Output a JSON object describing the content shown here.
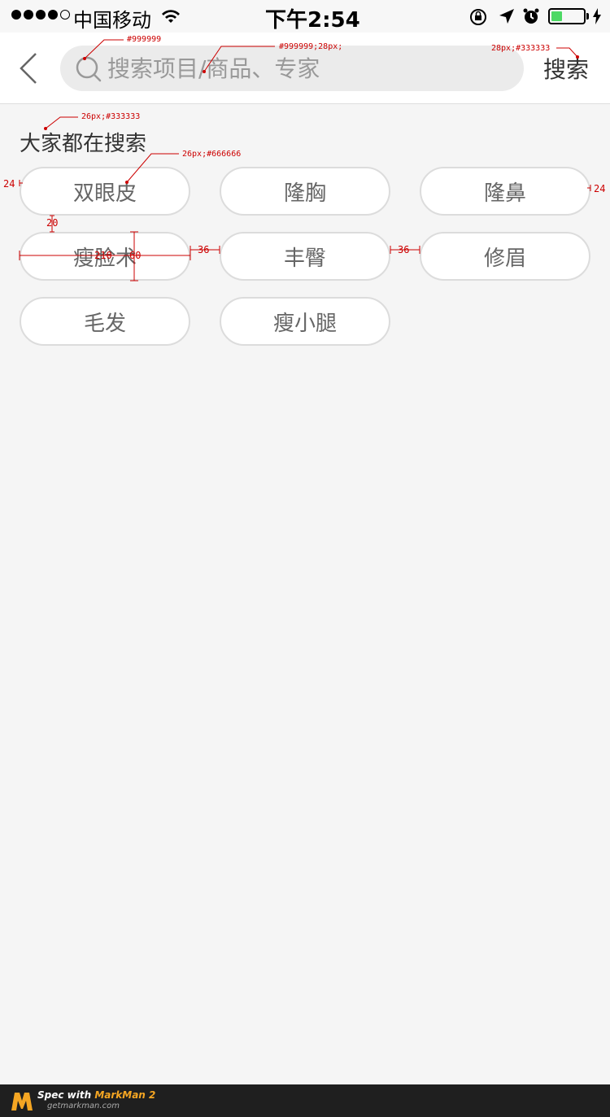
{
  "status_bar": {
    "carrier": "中国移动",
    "time": "下午2:54",
    "battery_level": 0.35,
    "battery_color": "#4cd964"
  },
  "header": {
    "back_icon": "chevron-left-icon",
    "search_icon": "search-icon",
    "search_placeholder": "搜索项目/商品、专家",
    "search_button": "搜索"
  },
  "popular": {
    "title": "大家都在搜索",
    "tags": [
      "双眼皮",
      "隆胸",
      "隆鼻",
      "瘦脸术",
      "丰臀",
      "修眉",
      "毛发",
      "瘦小腿"
    ]
  },
  "annotations": {
    "search_icon_color": "#999999",
    "placeholder_spec": "#999999;28px;",
    "search_button_spec": "28px;#333333",
    "title_spec": "26px;#333333",
    "tag_spec": "26px;#666666",
    "left_margin": "24",
    "right_margin": "24",
    "row_gap": "20",
    "tag_width": "210",
    "tag_height": "60",
    "col_gap_1": "36",
    "col_gap_2": "36"
  },
  "footer": {
    "line1_prefix": "Spec with ",
    "line1_brand": "MarkMan 2",
    "line2": "getmarkman.com"
  },
  "colors": {
    "text_primary": "#333333",
    "text_secondary": "#666666",
    "placeholder": "#999999",
    "background": "#f5f5f5",
    "annotation": "#cc0000"
  }
}
